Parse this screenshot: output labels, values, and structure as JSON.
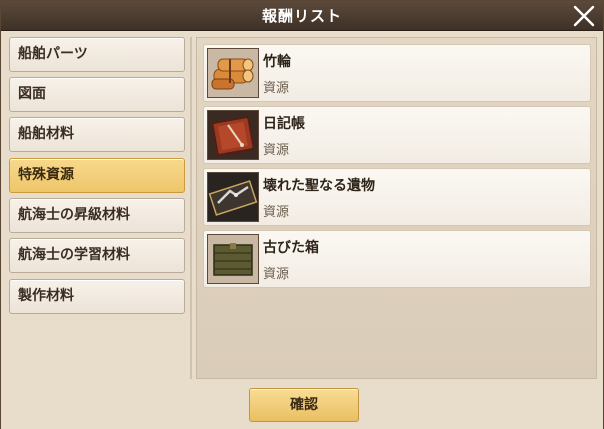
{
  "window": {
    "title": "報酬リスト"
  },
  "sidebar": {
    "items": [
      {
        "label": "船舶パーツ",
        "active": false
      },
      {
        "label": "図面",
        "active": false
      },
      {
        "label": "船舶材料",
        "active": false
      },
      {
        "label": "特殊資源",
        "active": true
      },
      {
        "label": "航海士の昇級材料",
        "active": false
      },
      {
        "label": "航海士の学習材料",
        "active": false
      },
      {
        "label": "製作材料",
        "active": false
      }
    ]
  },
  "rewards": [
    {
      "name": "竹輪",
      "type": "資源",
      "icon": "bamboo-bundle-icon"
    },
    {
      "name": "日記帳",
      "type": "資源",
      "icon": "diary-icon"
    },
    {
      "name": "壊れた聖なる遺物",
      "type": "資源",
      "icon": "broken-relic-icon"
    },
    {
      "name": "古びた箱",
      "type": "資源",
      "icon": "old-crate-icon"
    }
  ],
  "footer": {
    "confirm_label": "確認"
  },
  "colors": {
    "accent": "#eec66a",
    "title_bar": "#4a3a2e"
  }
}
